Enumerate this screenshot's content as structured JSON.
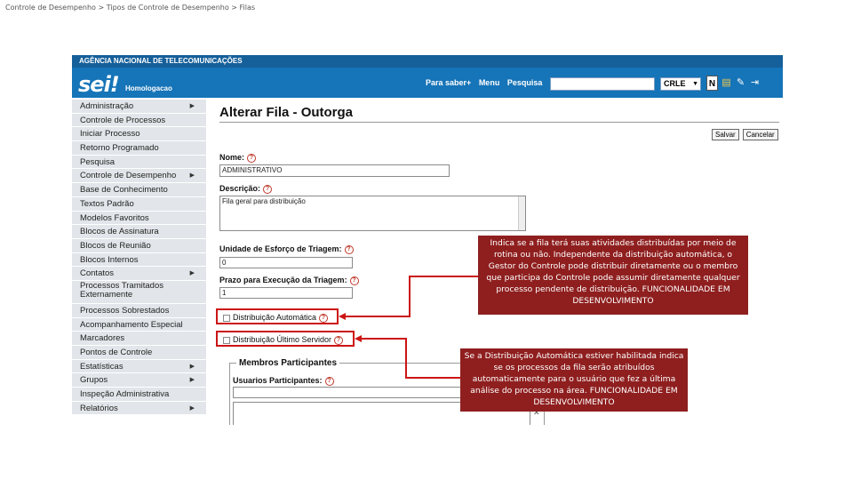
{
  "breadcrumb": "Controle de Desempenho > Tipos de Controle de Desempenho > Filas",
  "header": {
    "agency": "AGÊNCIA NACIONAL DE TELECOMUNICAÇÕES",
    "logo": "sei!",
    "environment": "Homologacao",
    "links": [
      "Para saber+",
      "Menu",
      "Pesquisa"
    ],
    "search_value": "",
    "unit": "CRLE",
    "icons": [
      "news-icon",
      "clipboard-icon",
      "tools-icon",
      "exit-icon"
    ]
  },
  "menu": [
    {
      "label": "Administração",
      "sub": true
    },
    {
      "label": "Controle de Processos",
      "sub": false
    },
    {
      "label": "Iniciar Processo",
      "sub": false
    },
    {
      "label": "Retorno Programado",
      "sub": false
    },
    {
      "label": "Pesquisa",
      "sub": false
    },
    {
      "label": "Controle de Desempenho",
      "sub": true
    },
    {
      "label": "Base de Conhecimento",
      "sub": false
    },
    {
      "label": "Textos Padrão",
      "sub": false
    },
    {
      "label": "Modelos Favoritos",
      "sub": false
    },
    {
      "label": "Blocos de Assinatura",
      "sub": false
    },
    {
      "label": "Blocos de Reunião",
      "sub": false
    },
    {
      "label": "Blocos Internos",
      "sub": false
    },
    {
      "label": "Contatos",
      "sub": true
    },
    {
      "label": "Processos Tramitados Externamente",
      "sub": false,
      "two_line": true
    },
    {
      "label": "Processos Sobrestados",
      "sub": false
    },
    {
      "label": "Acompanhamento Especial",
      "sub": false
    },
    {
      "label": "Marcadores",
      "sub": false
    },
    {
      "label": "Pontos de Controle",
      "sub": false
    },
    {
      "label": "Estatísticas",
      "sub": true
    },
    {
      "label": "Grupos",
      "sub": true
    },
    {
      "label": "Inspeção Administrativa",
      "sub": false
    },
    {
      "label": "Relatórios",
      "sub": true
    }
  ],
  "form": {
    "title": "Alterar Fila - Outorga",
    "save_label": "Salvar",
    "cancel_label": "Cancelar",
    "name_label": "Nome:",
    "name_value": "ADMINISTRATIVO",
    "description_label": "Descrição:",
    "description_value": "Fila geral para distribuição",
    "effort_label": "Unidade de Esforço de Triagem:",
    "effort_value": "0",
    "deadline_label": "Prazo para Execução da Triagem:",
    "deadline_value": "1",
    "auto_dist_label": "Distribuição Automática",
    "last_server_label": "Distribuição Último Servidor",
    "members_legend": "Membros Participantes",
    "participants_label": "Usuarios Participantes:"
  },
  "callouts": {
    "auto_dist": "Indica se a fila terá suas atividades distribuídas por meio de rotina ou não. Independente da distribuição automática, o Gestor do Controle pode distribuir diretamente ou o membro que participa do Controle pode assumir diretamente qualquer processo pendente de distribuição. FUNCIONALIDADE EM DESENVOLVIMENTO",
    "last_server": "Se a Distribuição Automática estiver habilitada indica se os processos da fila serão atribuídos automaticamente para o usuário que fez a última análise do processo na área. FUNCIONALIDADE EM DESENVOLVIMENTO"
  },
  "colors": {
    "header_blue": "#1674b8",
    "agency_blue": "#155f9a",
    "callout_bg": "#8f1f1f",
    "highlight_red": "#cc1414"
  }
}
